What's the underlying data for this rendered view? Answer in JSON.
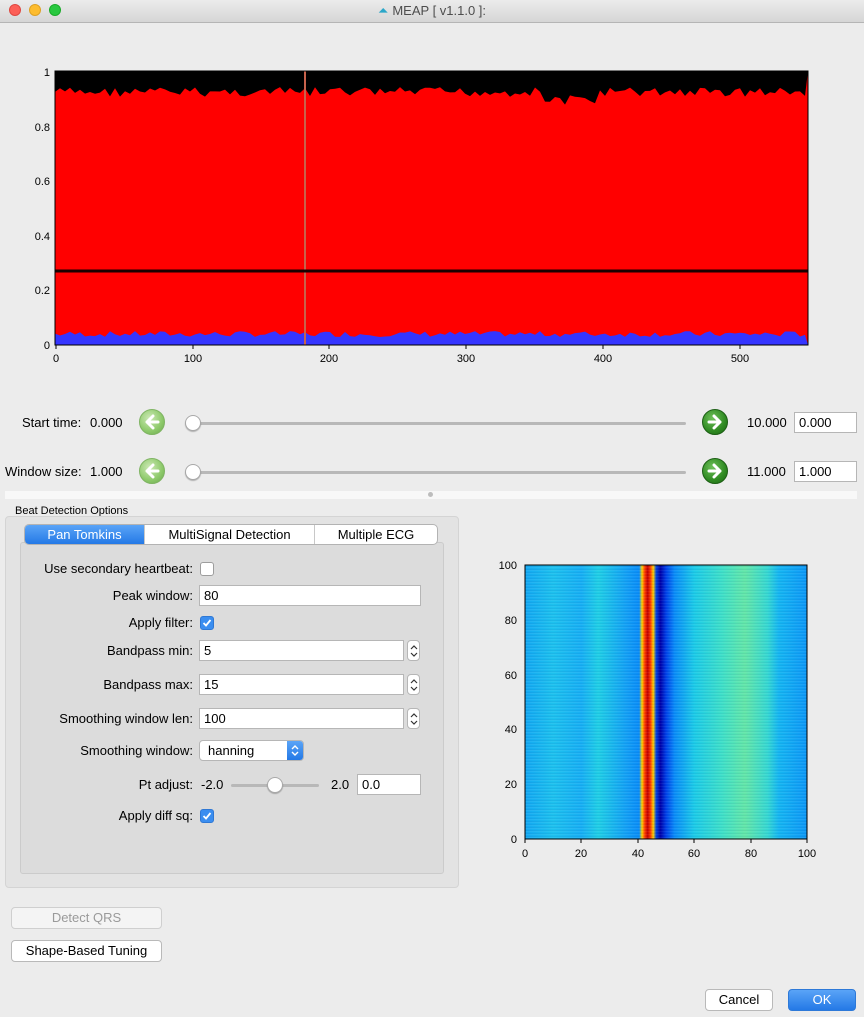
{
  "window": {
    "title": "MEAP [ v1.1.0 ]:"
  },
  "colors": {
    "accent": "#2479e6",
    "signal_red": "#ff0000",
    "baseline_blue": "#3b3bff",
    "arrow_green": "#2f8a22"
  },
  "top_plot": {
    "x_ticks": [
      "0",
      "100",
      "200",
      "300",
      "400",
      "500"
    ],
    "y_ticks": [
      "0",
      "0.2",
      "0.4",
      "0.6",
      "0.8",
      "1"
    ]
  },
  "start_time": {
    "label": "Start time:",
    "value": "0.000",
    "max": "10.000",
    "input": "0.000",
    "level": 0.0
  },
  "window_size": {
    "label": "Window size:",
    "value": "1.000",
    "max": "11.000",
    "input": "1.000",
    "level": 0.0
  },
  "beat_detection": {
    "title": "Beat Detection Options",
    "tabs": [
      "Pan Tomkins",
      "MultiSignal Detection",
      "Multiple ECG"
    ],
    "active_tab": 0,
    "options": {
      "use_secondary": {
        "label": "Use secondary heartbeat:",
        "checked": false
      },
      "peak_window": {
        "label": "Peak window:",
        "value": "80"
      },
      "apply_filter": {
        "label": "Apply filter:",
        "checked": true
      },
      "bandpass_min": {
        "label": "Bandpass min:",
        "value": "5"
      },
      "bandpass_max": {
        "label": "Bandpass max:",
        "value": "15"
      },
      "smoothing_len": {
        "label": "Smoothing window len:",
        "value": "100"
      },
      "smoothing_window": {
        "label": "Smoothing window:",
        "value": "hanning"
      },
      "pt_adjust": {
        "label": "Pt adjust:",
        "min": "-2.0",
        "max": "2.0",
        "value": "0.0",
        "level": 0.5
      },
      "apply_diff_sq": {
        "label": "Apply diff sq:",
        "checked": true
      }
    }
  },
  "heatmap": {
    "x_ticks": [
      "0",
      "20",
      "40",
      "60",
      "80",
      "100"
    ],
    "y_ticks": [
      "0",
      "20",
      "40",
      "60",
      "80",
      "100"
    ]
  },
  "buttons": {
    "detect_qrs": "Detect QRS",
    "shape_tuning": "Shape-Based Tuning",
    "cancel": "Cancel",
    "ok": "OK"
  }
}
